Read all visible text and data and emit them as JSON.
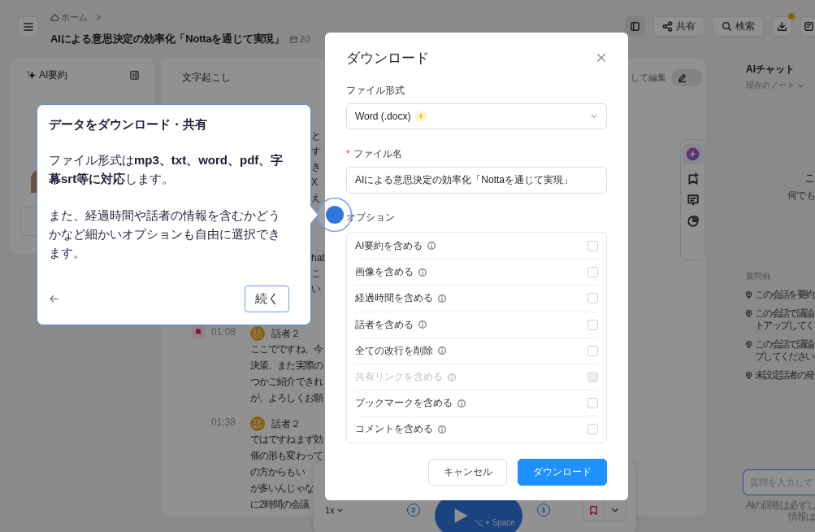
{
  "header": {
    "breadcrumb": {
      "home": "ホーム",
      "separator": ">"
    },
    "title": "AIによる意思決定の効率化「Nottaを通じて実現」",
    "date_fragment": "20",
    "toolbar": [
      {
        "kind": "panel",
        "selected": true
      },
      {
        "kind": "share",
        "label": "共有",
        "selected": false
      },
      {
        "kind": "search",
        "label": "検索",
        "selected": false
      },
      {
        "kind": "download",
        "badge": true,
        "selected": false
      },
      {
        "kind": "notes",
        "selected": false
      }
    ]
  },
  "summary_panel": {
    "title": "AI要約"
  },
  "transcript": {
    "title": "文字起こし",
    "edit_label": "して編集",
    "edit_on": false,
    "fragments": [
      [
        "と",
        "す",
        "き",
        "X",
        "え"
      ],
      [
        "hat",
        "こ",
        "い"
      ]
    ],
    "entries": [
      {
        "bookmarked": true,
        "time": "01:08",
        "avatar": "話",
        "speaker": "話者２",
        "lines": [
          "ここでですね、今",
          "決策、また実際の",
          "つかご紹介できれ",
          "が、よろしくお願"
        ]
      },
      {
        "bookmarked": false,
        "time": "01:38",
        "avatar": "話",
        "speaker": "話者２",
        "lines": [
          "ではですねまず効",
          "催の形も変わって",
          "の方からもい",
          "が多いんじゃな",
          "に2時間の会議"
        ]
      }
    ]
  },
  "player": {
    "speed": "1x",
    "back": "3",
    "shortcut": "⌥ + Space",
    "forward": "3"
  },
  "ai_chat": {
    "title": "AIチャット",
    "scope": "現在のノート",
    "greeting": "こ",
    "greeting_sub": "何でも",
    "examples_title": "質問例",
    "examples": [
      [
        "この会話を要約"
      ],
      [
        "この会話で議論",
        "トアップしてく"
      ],
      [
        "この会話で議論",
        "プしてください"
      ],
      [
        "未設定話者の発"
      ]
    ],
    "input_placeholder": "質問を入力して",
    "disclaimer": [
      "AIの回答は必ずし",
      "情報は"
    ]
  },
  "dialog": {
    "title": "ダウンロード",
    "format_label": "ファイル形式",
    "format_value": "Word (.docx)",
    "required_mark": "*",
    "filename_label": "ファイル名",
    "filename_value": "AIによる意思決定の効率化「Nottaを通じて実現」",
    "options_label": "オプション",
    "options": [
      {
        "label": "AI要約を含める",
        "checked": false,
        "disabled": false
      },
      {
        "label": "画像を含める",
        "checked": false,
        "disabled": false
      },
      {
        "label": "経過時間を含める",
        "checked": false,
        "disabled": false
      },
      {
        "label": "話者を含める",
        "checked": false,
        "disabled": false
      },
      {
        "label": "全ての改行を削除",
        "checked": false,
        "disabled": false
      },
      {
        "label": "共有リンクを含める",
        "checked": false,
        "disabled": true
      },
      {
        "label": "ブックマークを含める",
        "checked": false,
        "disabled": false
      },
      {
        "label": "コメントを含める",
        "checked": false,
        "disabled": false
      }
    ],
    "buttons": [
      {
        "kind": "secondary",
        "label": "キャンセル"
      },
      {
        "kind": "primary",
        "label": "ダウンロード"
      }
    ]
  },
  "tour": {
    "title": "データをダウンロード・共有",
    "paragraphs": [
      "ファイル形式は**mp3、txt、word、pdf、字幕srt等に対応**します。",
      "また、経過時間や話者の情報を含むかどうかなど細かいオプションも自由に選択できます。"
    ],
    "next": "続く"
  }
}
